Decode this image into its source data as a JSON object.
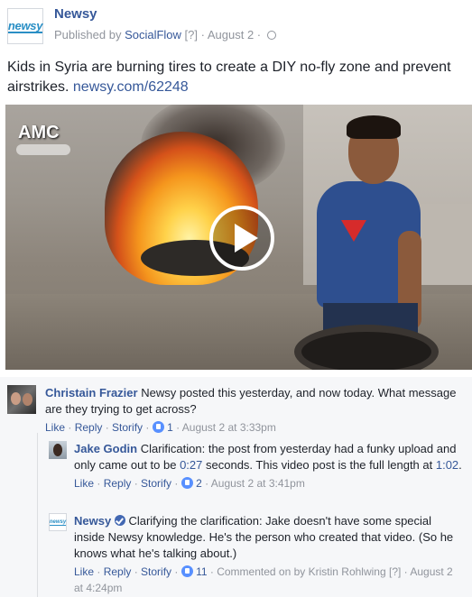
{
  "post": {
    "page_name": "Newsy",
    "logo_text": "newsy",
    "meta_prefix": "Published by ",
    "publisher": "SocialFlow",
    "help_mark": "[?]",
    "separator": " · ",
    "date": "August 2",
    "text": "Kids in Syria are burning tires to create a DIY no-fly zone and prevent airstrikes. ",
    "link": "newsy.com/62248"
  },
  "video": {
    "watermark": "AMC"
  },
  "comments": [
    {
      "author": "Christain Frazier",
      "text": " Newsy posted this yesterday, and now today. What message are they trying to get across?",
      "like_label": "Like",
      "reply_label": "Reply",
      "storify_label": "Storify",
      "reactions": "1",
      "timestamp": "August 2 at 3:33pm"
    },
    {
      "author": "Jake Godin",
      "text_before": " Clarification: the post from yesterday had a funky upload and only came out to be ",
      "time_link_1": "0:27",
      "text_middle": " seconds. This video post is the full length at ",
      "time_link_2": "1:02",
      "text_after": ".",
      "like_label": "Like",
      "reply_label": "Reply",
      "storify_label": "Storify",
      "reactions": "2",
      "timestamp": "August 2 at 3:41pm"
    },
    {
      "author": "Newsy",
      "logo_text": "newsy",
      "text": " Clarifying the clarification: Jake doesn't have some special inside Newsy knowledge. He's the person who created that video. (So he knows what he's talking about.)",
      "like_label": "Like",
      "reply_label": "Reply",
      "storify_label": "Storify",
      "reactions": "11",
      "commented_on": "Commented on by Kristin Rohlwing",
      "help_mark": "[?]",
      "timestamp": "August 2 at 4:24pm"
    }
  ]
}
